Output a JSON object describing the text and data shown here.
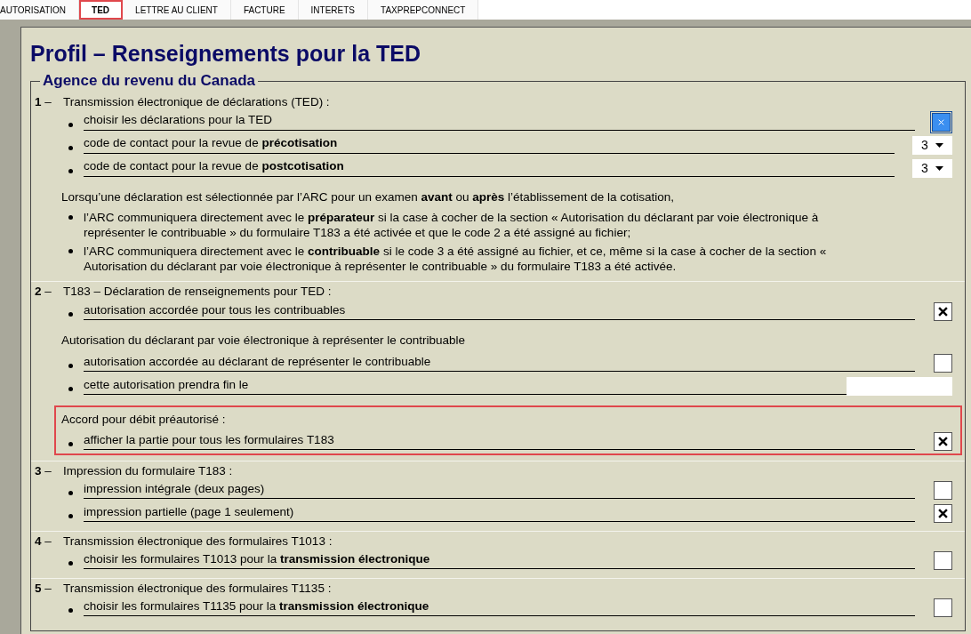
{
  "tabs": [
    {
      "label": "AUTORISATION",
      "selected": false,
      "highlighted": false
    },
    {
      "label": "TED",
      "selected": true,
      "highlighted": true
    },
    {
      "label": "LETTRE AU CLIENT",
      "selected": false,
      "highlighted": false
    },
    {
      "label": "FACTURE",
      "selected": false,
      "highlighted": false
    },
    {
      "label": "INTERETS",
      "selected": false,
      "highlighted": false
    },
    {
      "label": "TAXPREPCONNECT",
      "selected": false,
      "highlighted": false
    }
  ],
  "title": "Profil – Renseignements pour la TED",
  "group_title": "Agence du revenu du Canada",
  "sections": [
    {
      "number": "**1** –",
      "heading": "Transmission électronique de déclarations (TED) :",
      "blocks": [
        {
          "highlighted": false,
          "items": [
            {
              "kind": "checkbox",
              "label": "choisir les déclarations pour la TED",
              "checked": true,
              "focused": true
            },
            {
              "kind": "select",
              "label": "code de contact pour la revue de **précotisation**",
              "value": "3"
            },
            {
              "kind": "select",
              "label": "code de contact pour la revue de **postcotisation**",
              "value": "3"
            }
          ]
        },
        {
          "highlighted": false,
          "heading": "Lorsqu’une déclaration est sélectionnée par l’ARC pour un examen **avant** ou **après** l’établissement de la cotisation,",
          "items": [
            {
              "kind": "text",
              "label": "l’ARC communiquera directement avec le **préparateur** si la case à cocher de la section « Autorisation du déclarant par voie électronique à représenter le contribuable » du formulaire T183 a été activée et que le code 2 a été assigné au fichier;"
            },
            {
              "kind": "text",
              "label": "l’ARC communiquera directement avec le **contribuable** si le code 3 a été assigné au fichier, et ce, même si la case à cocher de la section « Autorisation du déclarant par voie électronique à représenter le contribuable » du formulaire T183 a été activée."
            }
          ]
        }
      ]
    },
    {
      "number": "**2** –",
      "heading": "T183 – Déclaration de renseignements pour TED :",
      "blocks": [
        {
          "highlighted": false,
          "items": [
            {
              "kind": "checkbox",
              "label": "autorisation accordée pour tous les contribuables",
              "checked": true,
              "focused": false
            }
          ]
        },
        {
          "highlighted": false,
          "heading": "Autorisation du déclarant par voie électronique à représenter le contribuable",
          "items": [
            {
              "kind": "checkbox",
              "label": "autorisation accordée au déclarant de représenter le contribuable",
              "checked": false,
              "focused": false
            },
            {
              "kind": "date",
              "label": "cette autorisation prendra fin le"
            }
          ]
        },
        {
          "highlighted": true,
          "heading": "Accord pour débit préautorisé :",
          "items": [
            {
              "kind": "checkbox",
              "label": "afficher la partie pour tous les formulaires T183",
              "checked": true,
              "focused": false
            }
          ]
        }
      ]
    },
    {
      "number": "**3** –",
      "heading": "Impression du formulaire T183 :",
      "blocks": [
        {
          "highlighted": false,
          "items": [
            {
              "kind": "checkbox",
              "label": "impression intégrale (deux pages)",
              "checked": false,
              "focused": false
            },
            {
              "kind": "checkbox",
              "label": "impression partielle (page 1 seulement)",
              "checked": true,
              "focused": false
            }
          ]
        }
      ]
    },
    {
      "number": "**4** –",
      "heading": "Transmission électronique des formulaires T1013 :",
      "blocks": [
        {
          "highlighted": false,
          "items": [
            {
              "kind": "checkbox",
              "label": "choisir les formulaires T1013 pour la **transmission électronique**",
              "checked": false,
              "focused": false
            }
          ]
        }
      ]
    },
    {
      "number": "**5** –",
      "heading": "Transmission électronique des formulaires T1135 :",
      "blocks": [
        {
          "highlighted": false,
          "items": [
            {
              "kind": "checkbox",
              "label": "choisir les formulaires T1135 pour la **transmission électronique**",
              "checked": false,
              "focused": false
            }
          ]
        }
      ]
    }
  ]
}
